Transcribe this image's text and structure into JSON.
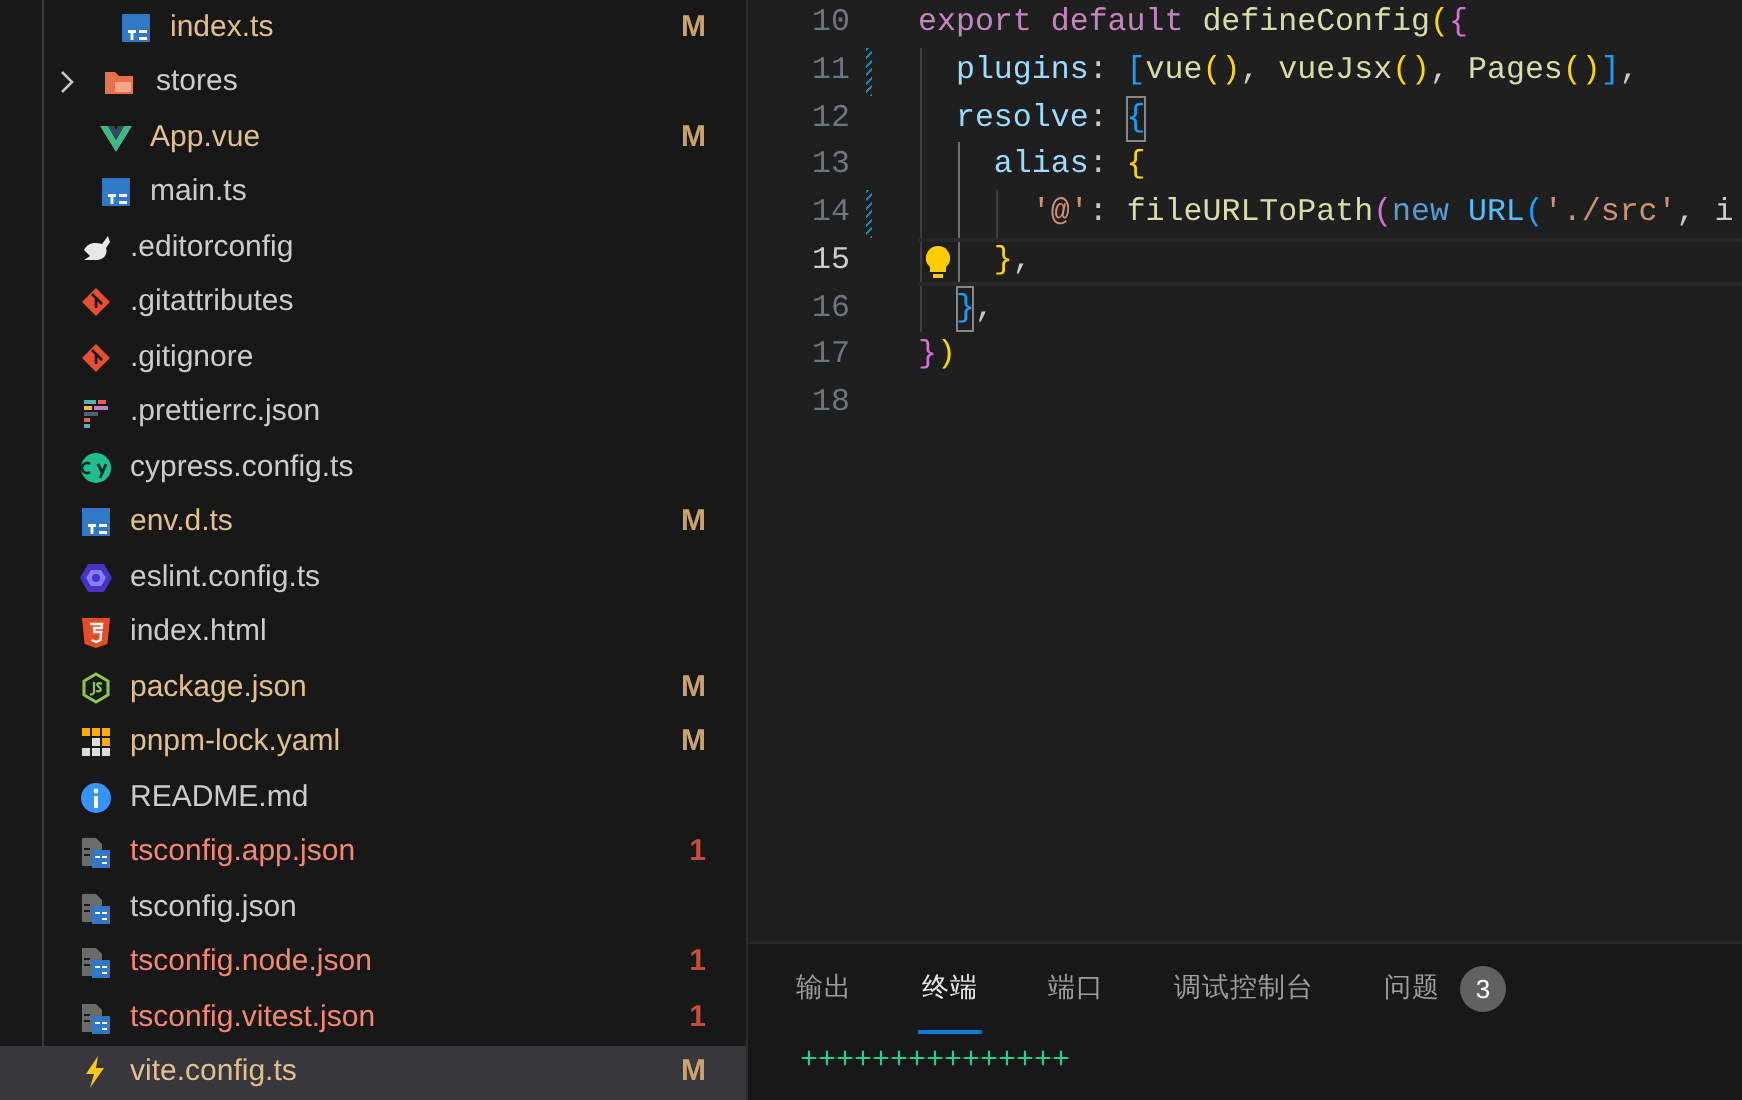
{
  "explorer": {
    "tree": [
      {
        "children": [
          {
            "children": [
              {
                "name": "index.ts",
                "kind": "ts",
                "modified": true,
                "errors": false,
                "badge": "M",
                "selected": false
              }
            ]
          },
          {
            "name": "stores",
            "kind": "folder",
            "expanded": false,
            "modified": false,
            "errors": false,
            "selected": false
          },
          {
            "name": "App.vue",
            "kind": "vue",
            "modified": true,
            "errors": false,
            "badge": "M",
            "selected": false
          },
          {
            "name": "main.ts",
            "kind": "ts",
            "modified": false,
            "errors": false,
            "selected": false
          }
        ]
      },
      {
        "name": ".editorconfig",
        "kind": "editorconfig",
        "modified": false,
        "errors": false,
        "selected": false
      },
      {
        "name": ".gitattributes",
        "kind": "git",
        "modified": false,
        "errors": false,
        "selected": false
      },
      {
        "name": ".gitignore",
        "kind": "git",
        "modified": false,
        "errors": false,
        "selected": false
      },
      {
        "name": ".prettierrc.json",
        "kind": "prettier",
        "modified": false,
        "errors": false,
        "selected": false
      },
      {
        "name": "cypress.config.ts",
        "kind": "cypress",
        "modified": false,
        "errors": false,
        "selected": false
      },
      {
        "name": "env.d.ts",
        "kind": "ts",
        "modified": true,
        "errors": false,
        "badge": "M",
        "selected": false
      },
      {
        "name": "eslint.config.ts",
        "kind": "eslint",
        "modified": false,
        "errors": false,
        "selected": false
      },
      {
        "name": "index.html",
        "kind": "html",
        "modified": false,
        "errors": false,
        "selected": false
      },
      {
        "name": "package.json",
        "kind": "node",
        "modified": true,
        "errors": false,
        "badge": "M",
        "selected": false
      },
      {
        "name": "pnpm-lock.yaml",
        "kind": "pnpm",
        "modified": true,
        "errors": false,
        "badge": "M",
        "selected": false
      },
      {
        "name": "README.md",
        "kind": "info",
        "modified": false,
        "errors": false,
        "selected": false
      },
      {
        "name": "tsconfig.app.json",
        "kind": "tsconfig",
        "errors": true,
        "badge": "1",
        "selected": false
      },
      {
        "name": "tsconfig.json",
        "kind": "tsconfig",
        "modified": false,
        "errors": false,
        "selected": false
      },
      {
        "name": "tsconfig.node.json",
        "kind": "tsconfig",
        "errors": true,
        "badge": "1",
        "selected": false
      },
      {
        "name": "tsconfig.vitest.json",
        "kind": "tsconfig",
        "errors": true,
        "badge": "1",
        "selected": false
      },
      {
        "name": "vite.config.ts",
        "kind": "vite",
        "modified": true,
        "errors": false,
        "badge": "M",
        "selected": true
      }
    ]
  },
  "editor": {
    "lines": [
      {
        "number": "10",
        "current": false,
        "changed": false,
        "lightbulb": false,
        "tokens": [
          {
            "text": "export default ",
            "kind": "keyword"
          },
          {
            "text": "defineConfig",
            "kind": "function"
          },
          {
            "text": "(",
            "kind": "bracket1"
          },
          {
            "text": "{",
            "kind": "bracket2"
          }
        ]
      },
      {
        "number": "11",
        "current": false,
        "changed": true,
        "lightbulb": false,
        "tokens": [
          {
            "text": "  plugins",
            "kind": "property"
          },
          {
            "text": ": ",
            "kind": "plain"
          },
          {
            "text": "[",
            "kind": "bracket3"
          },
          {
            "text": "vue",
            "kind": "function"
          },
          {
            "text": "()",
            "kind": "bracket1"
          },
          {
            "text": ", ",
            "kind": "plain"
          },
          {
            "text": "vueJsx",
            "kind": "function"
          },
          {
            "text": "()",
            "kind": "bracket1"
          },
          {
            "text": ", ",
            "kind": "plain"
          },
          {
            "text": "Pages",
            "kind": "function"
          },
          {
            "text": "()",
            "kind": "bracket1"
          },
          {
            "text": "]",
            "kind": "bracket3"
          },
          {
            "text": ",",
            "kind": "plain"
          }
        ]
      },
      {
        "number": "12",
        "current": false,
        "changed": false,
        "lightbulb": false,
        "tokens": [
          {
            "text": "  resolve",
            "kind": "property"
          },
          {
            "text": ": ",
            "kind": "plain"
          },
          {
            "text": "{",
            "kind": "bracket3",
            "matched": true
          }
        ]
      },
      {
        "number": "13",
        "current": false,
        "changed": false,
        "lightbulb": false,
        "tokens": [
          {
            "text": "    alias",
            "kind": "property"
          },
          {
            "text": ": ",
            "kind": "plain"
          },
          {
            "text": "{",
            "kind": "bracket1"
          }
        ]
      },
      {
        "number": "14",
        "current": false,
        "changed": true,
        "lightbulb": false,
        "tokens": [
          {
            "text": "      '@'",
            "kind": "string"
          },
          {
            "text": ": ",
            "kind": "plain"
          },
          {
            "text": "fileURLToPath",
            "kind": "function"
          },
          {
            "text": "(",
            "kind": "bracket2"
          },
          {
            "text": "new ",
            "kind": "storage"
          },
          {
            "text": "URL",
            "kind": "class"
          },
          {
            "text": "(",
            "kind": "bracket3"
          },
          {
            "text": "'./src'",
            "kind": "string"
          },
          {
            "text": ", i",
            "kind": "plain"
          }
        ]
      },
      {
        "number": "15",
        "current": true,
        "changed": false,
        "lightbulb": true,
        "tokens": [
          {
            "text": "    }",
            "kind": "bracket1"
          },
          {
            "text": ",",
            "kind": "plain"
          }
        ]
      },
      {
        "number": "16",
        "current": false,
        "changed": false,
        "lightbulb": false,
        "tokens": [
          {
            "text": "  }",
            "kind": "bracket3",
            "matched": true
          },
          {
            "text": ",",
            "kind": "plain"
          }
        ]
      },
      {
        "number": "17",
        "current": false,
        "changed": false,
        "lightbulb": false,
        "tokens": [
          {
            "text": "}",
            "kind": "bracket2"
          },
          {
            "text": ")",
            "kind": "bracket1"
          }
        ]
      },
      {
        "number": "18",
        "current": false,
        "changed": false,
        "lightbulb": false
      }
    ]
  },
  "panel": {
    "tabs": [
      {
        "label": "输出",
        "selected": false
      },
      {
        "label": "终端",
        "selected": true
      },
      {
        "label": "端口",
        "selected": false
      },
      {
        "label": "调试控制台",
        "selected": false
      },
      {
        "label": "问题",
        "selected": false,
        "count": "3"
      }
    ],
    "terminal": {
      "lines": [
        "+++++++++++++++"
      ]
    }
  }
}
